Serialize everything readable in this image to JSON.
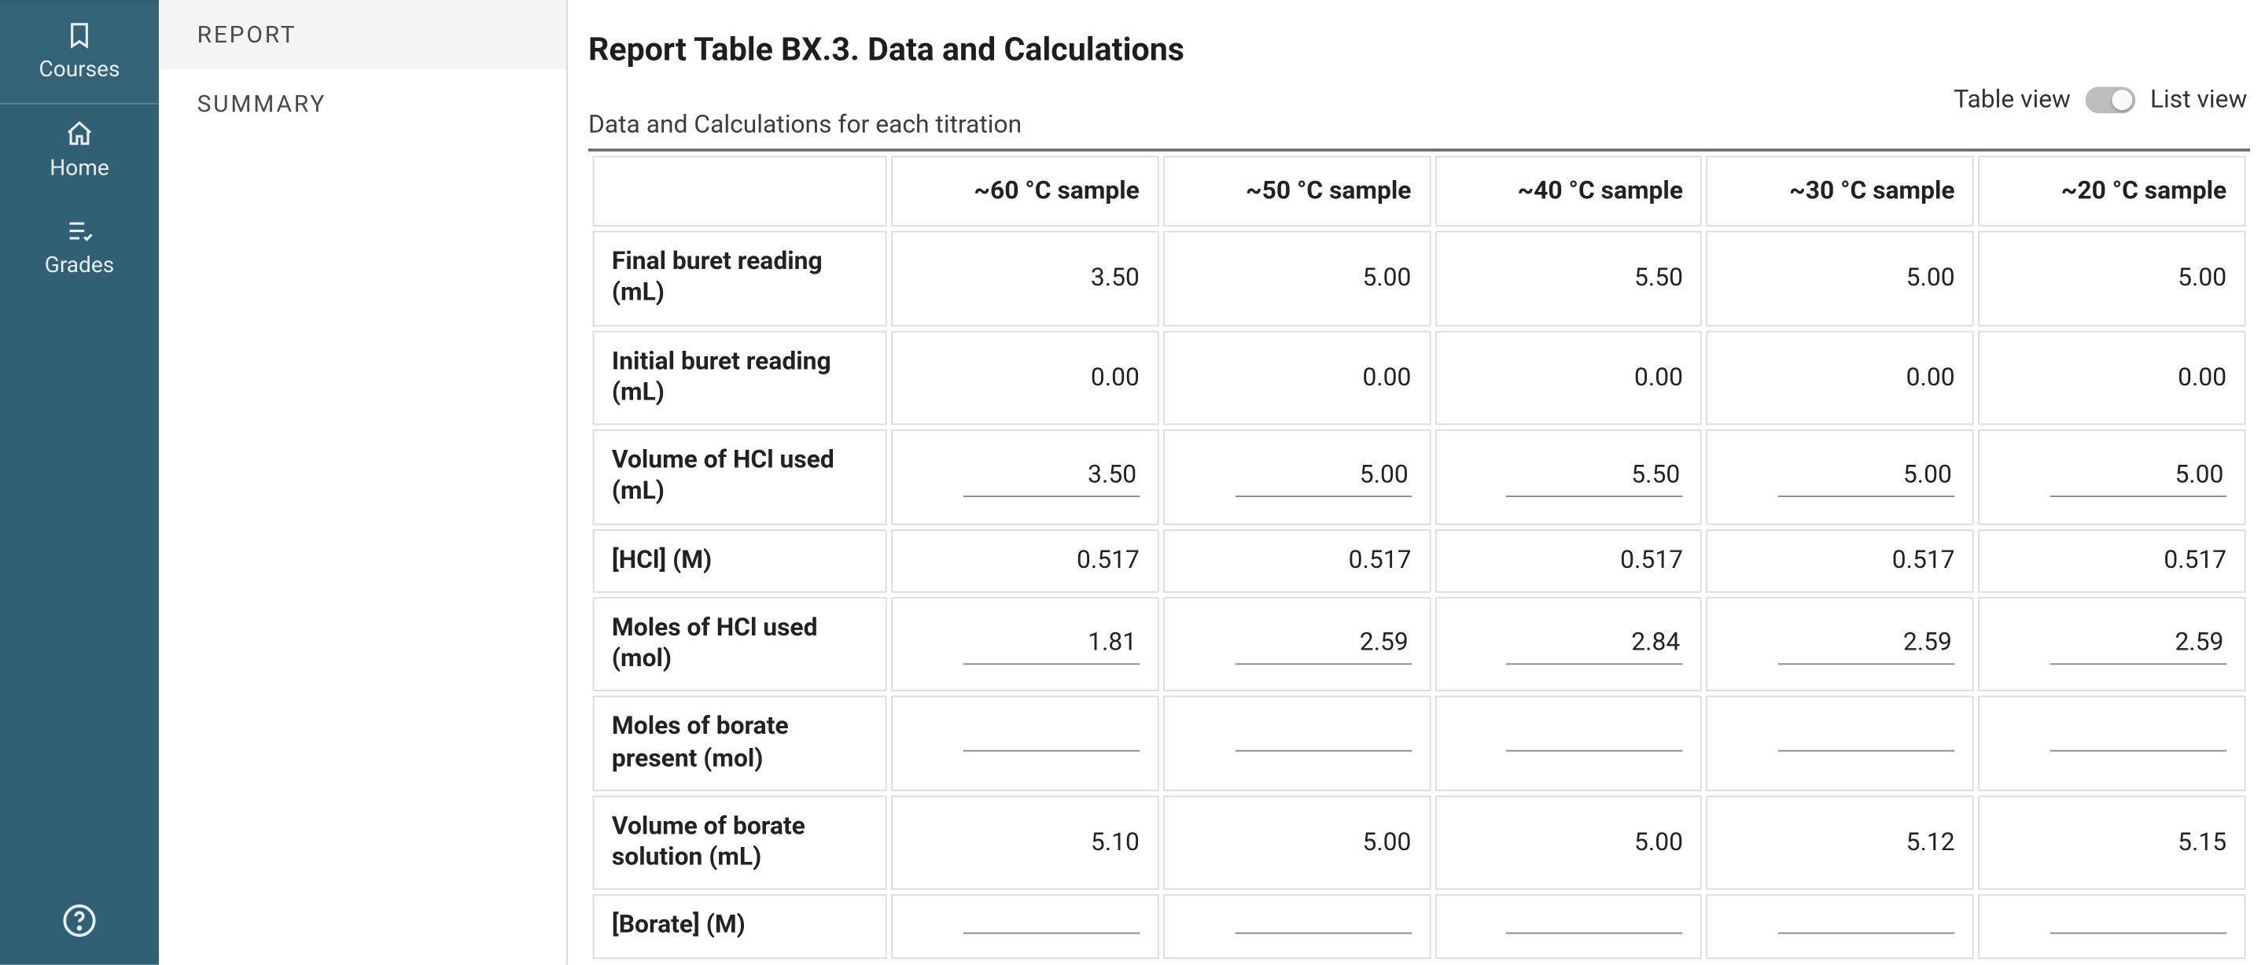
{
  "sidebar": {
    "items": [
      {
        "label": "Courses"
      },
      {
        "label": "Home"
      },
      {
        "label": "Grades"
      }
    ]
  },
  "subnav": {
    "items": [
      {
        "label": "REPORT",
        "active": true
      },
      {
        "label": "SUMMARY",
        "active": false
      }
    ]
  },
  "header": {
    "title": "Report Table BX.3. Data and Calculations",
    "subtitle": "Data and Calculations for each titration",
    "toggle_left": "Table view",
    "toggle_right": "List view"
  },
  "table": {
    "columns": [
      "~60 °C sample",
      "~50 °C sample",
      "~40 °C sample",
      "~30 °C sample",
      "~20 °C sample"
    ],
    "rows": [
      {
        "label": "Final buret reading (mL)",
        "vals": [
          "3.50",
          "5.00",
          "5.50",
          "5.00",
          "5.00"
        ],
        "editable": false
      },
      {
        "label": "Initial buret reading (mL)",
        "vals": [
          "0.00",
          "0.00",
          "0.00",
          "0.00",
          "0.00"
        ],
        "editable": false
      },
      {
        "label": "Volume of HCl used (mL)",
        "vals": [
          "3.50",
          "5.00",
          "5.50",
          "5.00",
          "5.00"
        ],
        "editable": true
      },
      {
        "label": "[HCl] (M)",
        "vals": [
          "0.517",
          "0.517",
          "0.517",
          "0.517",
          "0.517"
        ],
        "editable": false
      },
      {
        "label": "Moles of HCl used (mol)",
        "vals": [
          "1.81",
          "2.59",
          "2.84",
          "2.59",
          "2.59"
        ],
        "editable": true
      },
      {
        "label": "Moles of borate present (mol)",
        "vals": [
          "",
          "",
          "",
          "",
          ""
        ],
        "editable": true
      },
      {
        "label": "Volume of borate solution (mL)",
        "vals": [
          "5.10",
          "5.00",
          "5.00",
          "5.12",
          "5.15"
        ],
        "editable": false
      },
      {
        "label": "[Borate] (M)",
        "vals": [
          "",
          "",
          "",
          "",
          ""
        ],
        "editable": true
      }
    ]
  }
}
